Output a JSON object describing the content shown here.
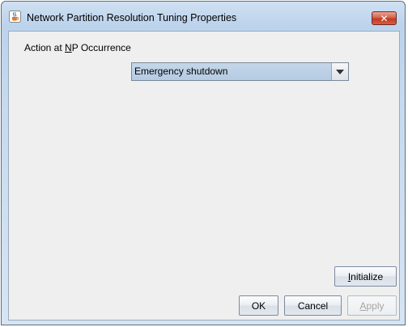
{
  "window": {
    "title": "Network Partition Resolution Tuning Properties",
    "icon": "java-cup-icon",
    "close_glyph": "✕"
  },
  "np_action": {
    "label_before": "Action at ",
    "label_mnemonic": "N",
    "label_after": "P Occurrence",
    "selected_value": "Emergency shutdown"
  },
  "buttons": {
    "initialize_mnemonic": "I",
    "initialize_rest": "nitialize",
    "ok": "OK",
    "cancel": "Cancel",
    "apply_mnemonic": "A",
    "apply_rest": "pply"
  },
  "colors": {
    "close_button": "#c23a22",
    "combo_background": "#b8cfe5",
    "panel_background": "#efefef"
  }
}
